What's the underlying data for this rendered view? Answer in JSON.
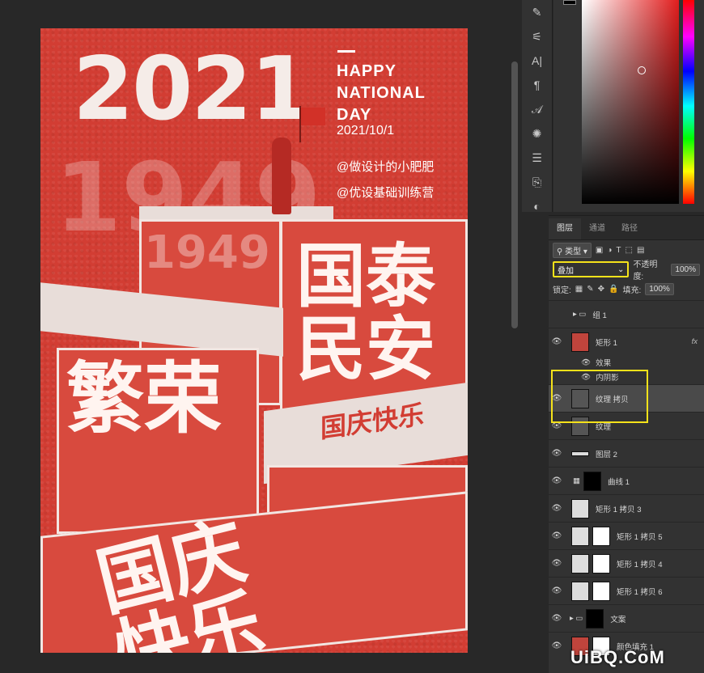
{
  "poster": {
    "year": "2021",
    "ghost_year": "1949",
    "title_lines": [
      "HAPPY",
      "NATIONAL",
      "DAY"
    ],
    "date": "2021/10/1",
    "handle1": "@做设计的小肥肥",
    "handle2": "@优设基础训练营",
    "box1_side": "国泰民安",
    "box1_top": "1949",
    "box2_side": "繁荣",
    "box3_top": "国庆快乐",
    "box4_top": "国庆快乐"
  },
  "panel": {
    "tabs": [
      "图层",
      "通道",
      "路径"
    ],
    "filter_label": "类型",
    "blend_mode": "叠加",
    "opacity_label": "不透明度:",
    "opacity_value": "100%",
    "lock_label": "锁定:",
    "fill_label": "填充:",
    "fill_value": "100%",
    "layers": [
      {
        "name": "组 1"
      },
      {
        "name": "矩形 1",
        "fx": "fx"
      },
      {
        "name": "效果"
      },
      {
        "name": "内阴影"
      },
      {
        "name": "纹理 拷贝"
      },
      {
        "name": "纹理"
      },
      {
        "name": "图层 2"
      },
      {
        "name": "曲线 1"
      },
      {
        "name": "矩形 1 拷贝 3"
      },
      {
        "name": "矩形 1 拷贝 5"
      },
      {
        "name": "矩形 1 拷贝 4"
      },
      {
        "name": "矩形 1 拷贝 6"
      },
      {
        "name": "文案"
      },
      {
        "name": "颜色填充 1"
      }
    ]
  },
  "watermark": "UiBQ.CoM",
  "colors": {
    "poster_red": "#d23d33",
    "highlight": "#f5e21a",
    "panel_bg": "#323232"
  }
}
